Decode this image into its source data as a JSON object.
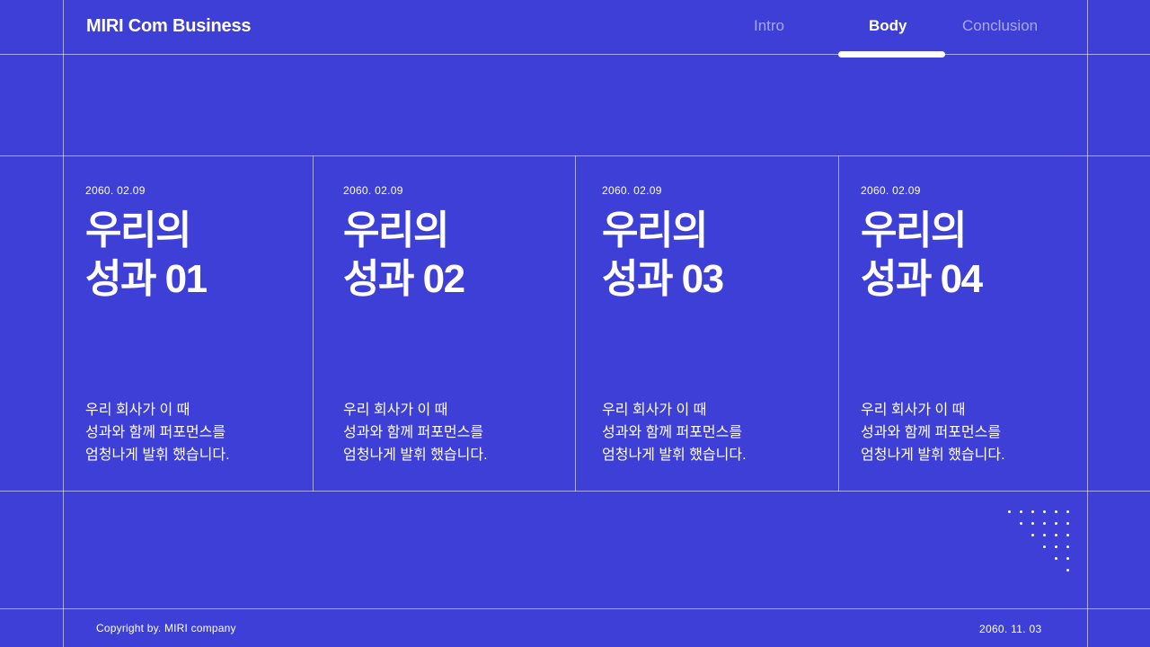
{
  "header": {
    "brand": "MIRI Com Business",
    "nav": [
      {
        "label": "Intro",
        "active": false
      },
      {
        "label": "Body",
        "active": true
      },
      {
        "label": "Conclusion",
        "active": false
      }
    ]
  },
  "cards": [
    {
      "date": "2060. 02.09",
      "title_line1": "우리의",
      "title_line2": "성과 01",
      "desc": [
        "우리 회사가 이 때",
        "성과와 함께 퍼포먼스를",
        "엄청나게 발휘 했습니다."
      ]
    },
    {
      "date": "2060. 02.09",
      "title_line1": "우리의",
      "title_line2": "성과 02",
      "desc": [
        "우리 회사가 이 때",
        "성과와 함께 퍼포먼스를",
        "엄청나게 발휘 했습니다."
      ]
    },
    {
      "date": "2060. 02.09",
      "title_line1": "우리의",
      "title_line2": "성과 03",
      "desc": [
        "우리 회사가 이 때",
        "성과와 함께 퍼포먼스를",
        "엄청나게 발휘 했습니다."
      ]
    },
    {
      "date": "2060. 02.09",
      "title_line1": "우리의",
      "title_line2": "성과 04",
      "desc": [
        "우리 회사가 이 때",
        "성과와 함께 퍼포먼스를",
        "엄청나게 발휘 했습니다."
      ]
    }
  ],
  "footer": {
    "copyright": "Copyright by. MIRI company",
    "date": "2060. 11. 03"
  },
  "colors": {
    "background": "#3d3fd6",
    "text": "#ffffff"
  }
}
